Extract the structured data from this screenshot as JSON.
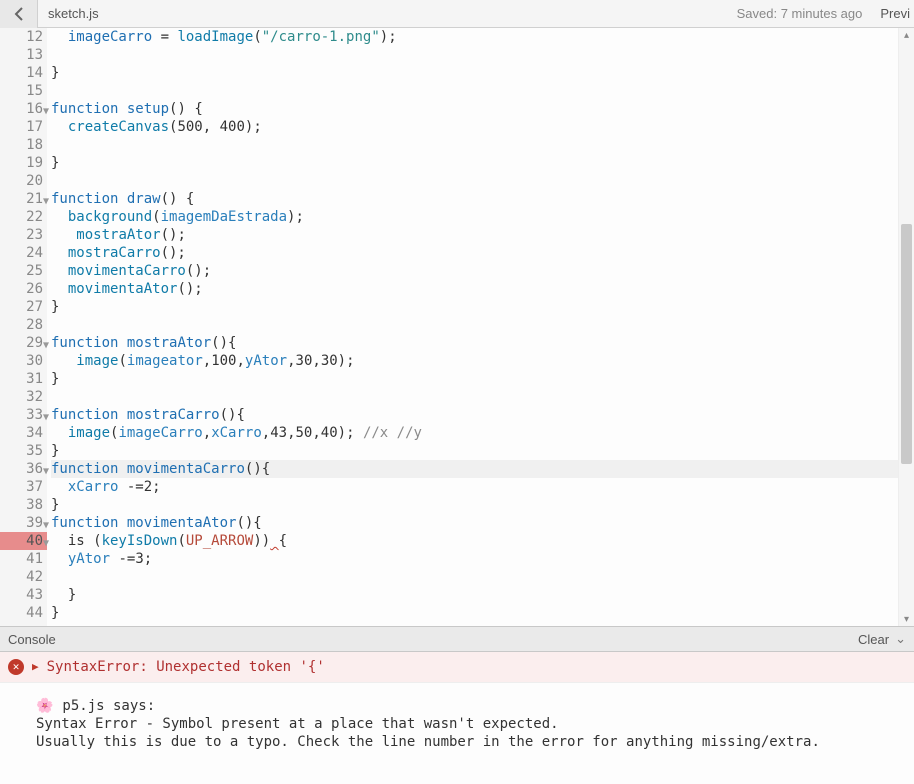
{
  "topbar": {
    "filename": "sketch.js",
    "saved_status": "Saved: 7 minutes ago",
    "preview_label": "Previ"
  },
  "editor": {
    "first_line_no": 12,
    "lines": [
      {
        "n": 12,
        "fold": false,
        "html": "  <span class='tok-var'>imageCarro</span> = <span class='tok-fn'>loadImage</span>(<span class='tok-str'>\"/carro-1.png\"</span>);"
      },
      {
        "n": 13,
        "fold": false,
        "html": ""
      },
      {
        "n": 14,
        "fold": false,
        "html": "}"
      },
      {
        "n": 15,
        "fold": false,
        "html": ""
      },
      {
        "n": 16,
        "fold": true,
        "html": "<span class='tok-kw'>function</span> <span class='tok-def'>setup</span>() {"
      },
      {
        "n": 17,
        "fold": false,
        "html": "  <span class='tok-fn'>createCanvas</span>(<span class='tok-num'>500</span>, <span class='tok-num'>400</span>);"
      },
      {
        "n": 18,
        "fold": false,
        "html": ""
      },
      {
        "n": 19,
        "fold": false,
        "html": "}"
      },
      {
        "n": 20,
        "fold": false,
        "html": ""
      },
      {
        "n": 21,
        "fold": true,
        "html": "<span class='tok-kw'>function</span> <span class='tok-def'>draw</span>() {"
      },
      {
        "n": 22,
        "fold": false,
        "html": "  <span class='tok-fn'>background</span>(<span class='tok-id'>imagemDaEstrada</span>);"
      },
      {
        "n": 23,
        "fold": false,
        "html": "   <span class='tok-fn'>mostraAtor</span>();"
      },
      {
        "n": 24,
        "fold": false,
        "html": "  <span class='tok-fn'>mostraCarro</span>();"
      },
      {
        "n": 25,
        "fold": false,
        "html": "  <span class='tok-fn'>movimentaCarro</span>();"
      },
      {
        "n": 26,
        "fold": false,
        "html": "  <span class='tok-fn'>movimentaAtor</span>();"
      },
      {
        "n": 27,
        "fold": false,
        "html": "}"
      },
      {
        "n": 28,
        "fold": false,
        "html": ""
      },
      {
        "n": 29,
        "fold": true,
        "html": "<span class='tok-kw'>function</span> <span class='tok-def'>mostraAtor</span>(){"
      },
      {
        "n": 30,
        "fold": false,
        "html": "   <span class='tok-fn'>image</span>(<span class='tok-id'>imageator</span>,<span class='tok-num'>100</span>,<span class='tok-id'>yAtor</span>,<span class='tok-num'>30</span>,<span class='tok-num'>30</span>);"
      },
      {
        "n": 31,
        "fold": false,
        "html": "}"
      },
      {
        "n": 32,
        "fold": false,
        "html": ""
      },
      {
        "n": 33,
        "fold": true,
        "html": "<span class='tok-kw'>function</span> <span class='tok-def'>mostraCarro</span>(){"
      },
      {
        "n": 34,
        "fold": false,
        "html": "  <span class='tok-fn'>image</span>(<span class='tok-id'>imageCarro</span>,<span class='tok-id'>xCarro</span>,<span class='tok-num'>43</span>,<span class='tok-num'>50</span>,<span class='tok-num'>40</span>); <span class='tok-cmt'>//x //y</span>"
      },
      {
        "n": 35,
        "fold": false,
        "html": "}"
      },
      {
        "n": 36,
        "fold": true,
        "hl": true,
        "html": "<span class='tok-kw'>function</span> <span class='tok-def'>movimentaCarro</span>(){"
      },
      {
        "n": 37,
        "fold": false,
        "html": "  <span class='tok-id'>xCarro</span> -=<span class='tok-num'>2</span>;"
      },
      {
        "n": 38,
        "fold": false,
        "html": "}"
      },
      {
        "n": 39,
        "fold": true,
        "html": "<span class='tok-kw'>function</span> <span class='tok-def'>movimentaAtor</span>(){"
      },
      {
        "n": 40,
        "fold": true,
        "err": true,
        "html": "  is (<span class='tok-fn'>keyIsDown</span>(<span class='tok-const'>UP_ARROW</span>))<span class='squiggle'>&nbsp;</span>{"
      },
      {
        "n": 41,
        "fold": false,
        "html": "  <span class='tok-id'>yAtor</span> -=<span class='tok-num'>3</span>;"
      },
      {
        "n": 42,
        "fold": false,
        "html": ""
      },
      {
        "n": 43,
        "fold": false,
        "html": "  }"
      },
      {
        "n": 44,
        "fold": false,
        "html": "}"
      }
    ]
  },
  "console": {
    "title": "Console",
    "clear_label": "Clear",
    "error_line": "SyntaxError: Unexpected token '{'",
    "flower": "🌸",
    "says_line": " p5.js says:",
    "msg_line1": "Syntax Error - Symbol present at a place that wasn't expected.",
    "msg_line2": "Usually this is due to a typo. Check the line number in the error for anything missing/extra."
  }
}
